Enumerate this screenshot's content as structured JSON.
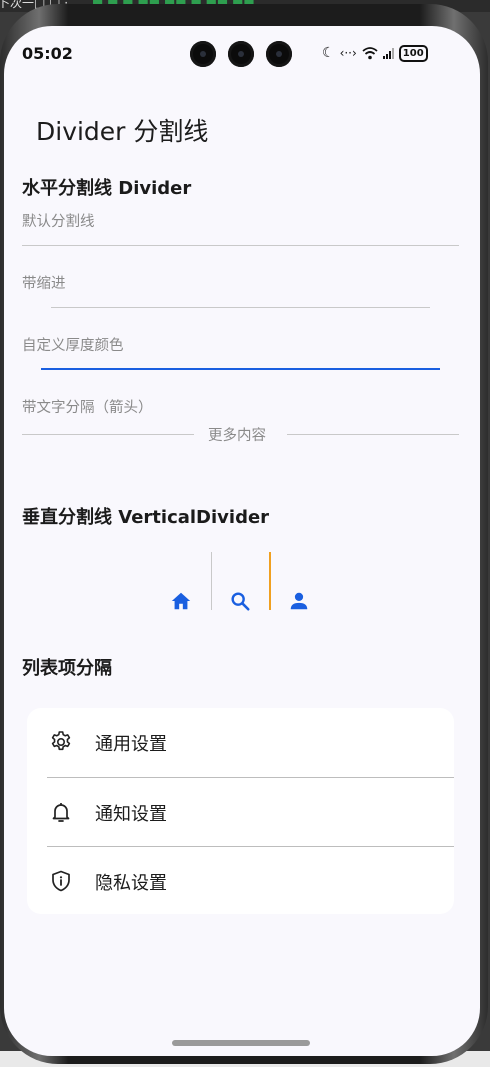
{
  "status_bar": {
    "time": "05:02",
    "battery": "100"
  },
  "app": {
    "title": "Divider 分割线"
  },
  "horizontal": {
    "title": "水平分割线 Divider",
    "default_label": "默认分割线",
    "indent_label": "带缩进",
    "custom_label": "自定义厚度颜色",
    "text_label": "带文字分隔（箭头）",
    "divider_text": "更多内容"
  },
  "vertical": {
    "title": "垂直分割线 VerticalDivider",
    "icons": [
      "home-icon",
      "search-icon",
      "person-icon"
    ]
  },
  "list": {
    "title": "列表项分隔",
    "items": [
      {
        "label": "通用设置",
        "icon": "gear-icon"
      },
      {
        "label": "通知设置",
        "icon": "bell-icon"
      },
      {
        "label": "隐私设置",
        "icon": "shield-icon"
      }
    ]
  },
  "colors": {
    "accent": "#1a5fe0",
    "orange": "#f0a020",
    "divider_gray": "#c9c9c9",
    "background": "#f9f8fd"
  }
}
